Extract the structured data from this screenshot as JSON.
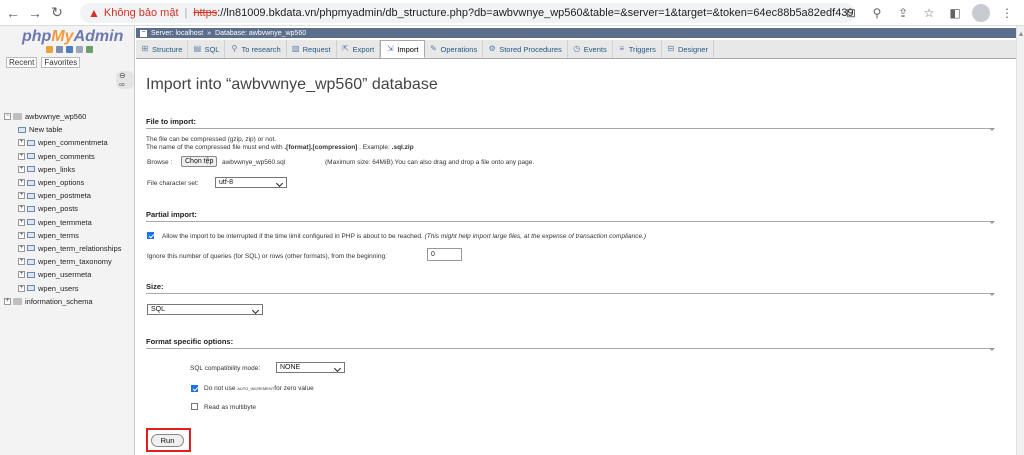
{
  "browser": {
    "security_warning": "Không bảo mật",
    "separator": "|",
    "url_protocol": "https",
    "url_rest": "://ln81009.bkdata.vn/phpmyadmin/db_structure.php?db=awbvwnye_wp560&table=&server=1&target=&token=64ec88b5a82edf439..."
  },
  "sidebar": {
    "logo_php": "php",
    "logo_my": "My",
    "logo_admin": "Admin",
    "recent": "Recent",
    "favorites": "Favorites",
    "tree": [
      {
        "label": "awbvwnye_wp560",
        "level": 0,
        "type": "db",
        "expander": "−"
      },
      {
        "label": "New table",
        "level": 1,
        "type": "new",
        "expander": ""
      },
      {
        "label": "wpen_commentmeta",
        "level": 1,
        "type": "table",
        "expander": "+"
      },
      {
        "label": "wpen_comments",
        "level": 1,
        "type": "table",
        "expander": "+"
      },
      {
        "label": "wpen_links",
        "level": 1,
        "type": "table",
        "expander": "+"
      },
      {
        "label": "wpen_options",
        "level": 1,
        "type": "table",
        "expander": "+"
      },
      {
        "label": "wpen_postmeta",
        "level": 1,
        "type": "table",
        "expander": "+"
      },
      {
        "label": "wpen_posts",
        "level": 1,
        "type": "table",
        "expander": "+"
      },
      {
        "label": "wpen_termmeta",
        "level": 1,
        "type": "table",
        "expander": "+"
      },
      {
        "label": "wpen_terms",
        "level": 1,
        "type": "table",
        "expander": "+"
      },
      {
        "label": "wpen_term_relationships",
        "level": 1,
        "type": "table",
        "expander": "+"
      },
      {
        "label": "wpen_term_taxonomy",
        "level": 1,
        "type": "table",
        "expander": "+"
      },
      {
        "label": "wpen_usermeta",
        "level": 1,
        "type": "table",
        "expander": "+"
      },
      {
        "label": "wpen_users",
        "level": 1,
        "type": "table",
        "expander": "+"
      },
      {
        "label": "information_schema",
        "level": 0,
        "type": "db",
        "expander": "+"
      }
    ]
  },
  "breadcrumb": {
    "server": "Server: localhost",
    "arrow": "»",
    "database": "Database: awbvwnye_wp560"
  },
  "tabs": [
    {
      "label": "Structure",
      "icon": "structure-icon",
      "glyph": "⊞"
    },
    {
      "label": "SQL",
      "icon": "sql-icon",
      "glyph": "▤"
    },
    {
      "label": "To research",
      "icon": "search-icon",
      "glyph": "⚲"
    },
    {
      "label": "Request",
      "icon": "query-icon",
      "glyph": "▧"
    },
    {
      "label": "Export",
      "icon": "export-icon",
      "glyph": "⇱"
    },
    {
      "label": "Import",
      "icon": "import-icon",
      "glyph": "⇲",
      "active": true
    },
    {
      "label": "Operations",
      "icon": "operations-icon",
      "glyph": "✎"
    },
    {
      "label": "Stored Procedures",
      "icon": "routines-icon",
      "glyph": "⚙"
    },
    {
      "label": "Events",
      "icon": "events-icon",
      "glyph": "◷"
    },
    {
      "label": "Triggers",
      "icon": "triggers-icon",
      "glyph": "≡"
    },
    {
      "label": "Designer",
      "icon": "designer-icon",
      "glyph": "⊟"
    }
  ],
  "main": {
    "title": "Import into “awbvwnye_wp560” database",
    "file_section": {
      "heading": "File to import:",
      "line1": "The file can be compressed (gzip, zip) or not.",
      "line2_prefix": "The name of the compressed file must end with ",
      "line2_bold": ".[format].[compression]",
      "line2_mid": " . Example: ",
      "line2_example": ".sql.zip",
      "browse_label": "Browse :",
      "choose_button": "Chọn tệp",
      "file_name": "awbvwnye_wp560.sql",
      "max_size": "(Maximum size: 64MiB) You can also drag and drop a file onto any page.",
      "charset_label": "File character set:",
      "charset_value": "utf-8"
    },
    "partial_section": {
      "heading": "Partial import:",
      "interrupt_text": "Allow the import to be interrupted if the time limit configured in PHP is about to be reached.",
      "interrupt_note": "(This might help import large files, at the expense of transaction compliance.)",
      "interrupt_checked": true,
      "skip_label": "Ignore this number of queries (for SQL) or rows (other formats), from the beginning:",
      "skip_value": "0"
    },
    "size_section": {
      "heading": "Size:",
      "format_value": "SQL"
    },
    "format_section": {
      "heading": "Format specific options:",
      "compat_label": "SQL compatibility mode:",
      "compat_value": "NONE",
      "no_auto_prefix": "Do not use ",
      "no_auto_code": "AUTO_INCREMENT",
      "no_auto_suffix": "for zero value",
      "no_auto_checked": true,
      "multibyte_label": "Read as multibyte",
      "multibyte_checked": false
    },
    "run_button": "Run"
  },
  "colors": {
    "highlight_border": "#e02020",
    "warning": "#d93025",
    "nav_bar": "#5b6e8b"
  }
}
